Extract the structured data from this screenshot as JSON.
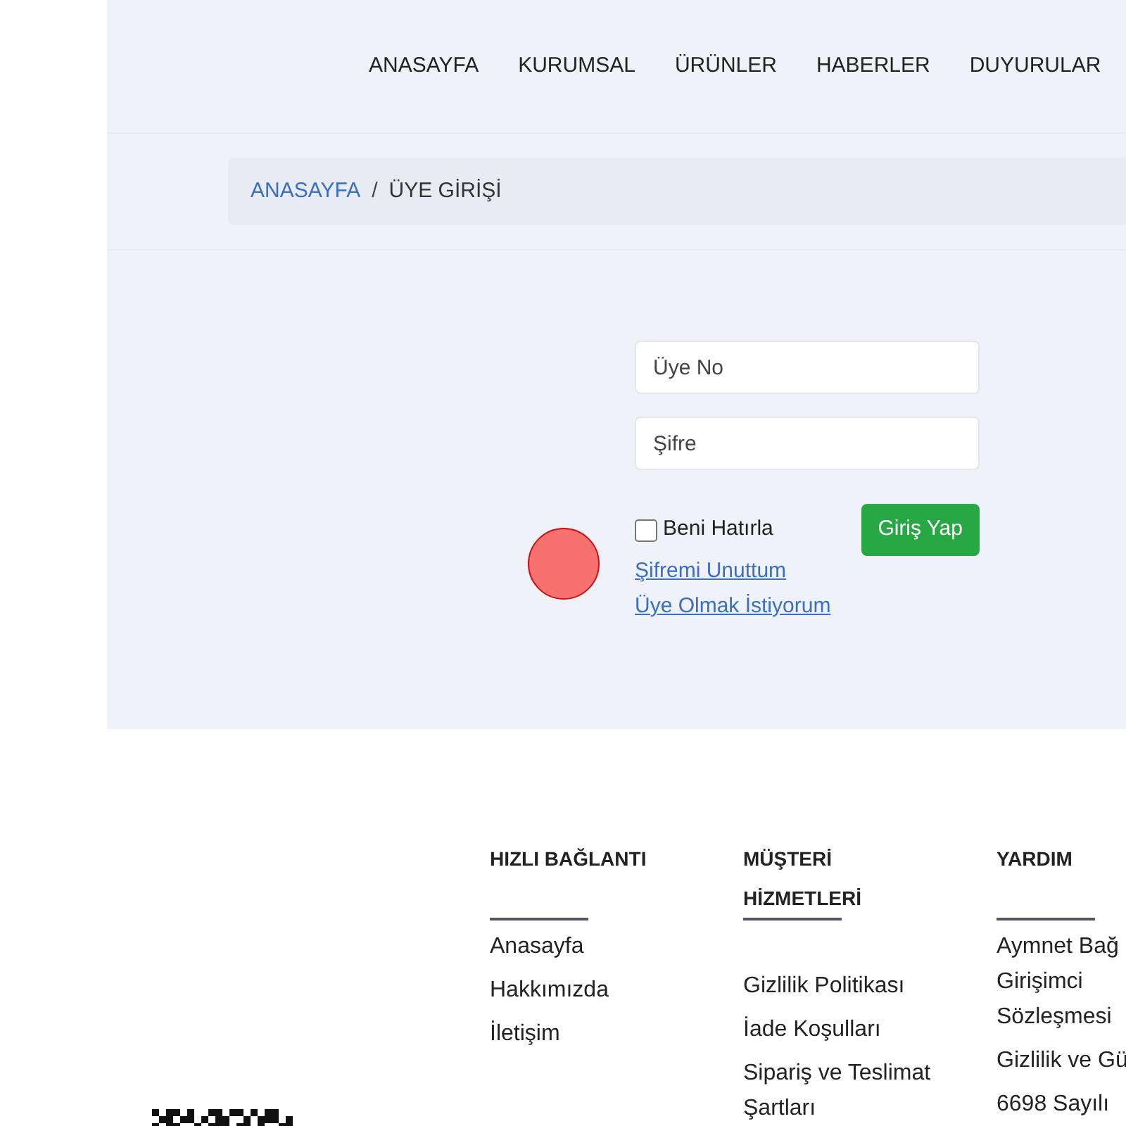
{
  "nav": {
    "items": [
      "ANASAYFA",
      "KURUMSAL",
      "ÜRÜNLER",
      "HABERLER",
      "DUYURULAR"
    ]
  },
  "breadcrumb": {
    "items": [
      {
        "label": "ANASAYFA",
        "kind": "link"
      },
      {
        "label": "ÜYE GİRİŞİ",
        "kind": "current"
      }
    ],
    "separator": "/"
  },
  "login": {
    "member_no": {
      "placeholder": "Üye No"
    },
    "password": {
      "placeholder": "Şifre"
    },
    "remember": {
      "label": "Beni Hatırla",
      "checked": false
    },
    "submit": "Giriş Yap",
    "links": [
      "Şifremi Unuttum",
      "Üye Olmak İstiyorum"
    ]
  },
  "footer": {
    "columns": [
      {
        "heading": "HIZLI BAĞLANTI",
        "items": [
          {
            "lines": [
              "Anasayfa"
            ]
          },
          {
            "lines": [
              "Hakkımızda"
            ]
          },
          {
            "lines": [
              "İletişim"
            ]
          }
        ]
      },
      {
        "heading": "MÜŞTERİ HİZMETLERİ",
        "items": [
          {
            "lines": [
              "Gizlilik Politikası"
            ]
          },
          {
            "lines": [
              "İade Koşulları"
            ]
          },
          {
            "lines": [
              "Sipariş ve Teslimat",
              "Şartları"
            ]
          }
        ]
      },
      {
        "heading": "YARDIM",
        "items": [
          {
            "lines": [
              "Aymnet Bağ",
              "Girişimci",
              "Sözleşmesi"
            ]
          },
          {
            "lines": [
              "Gizlilik ve Gü"
            ]
          },
          {
            "lines": [
              "6698 Sayılı"
            ]
          }
        ]
      }
    ]
  }
}
